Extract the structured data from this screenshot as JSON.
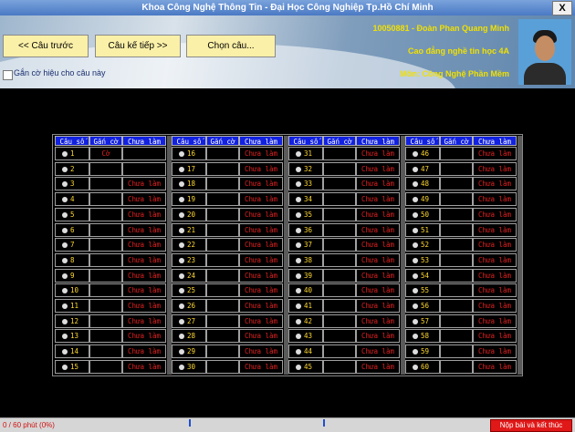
{
  "window": {
    "title": "Khoa Công Nghệ Thông Tin - Đại Học Công Nghiệp Tp.Hồ Chí Minh",
    "close_label": "X"
  },
  "toolbar": {
    "prev_label": "<< Câu trước",
    "next_label": "Câu kế tiếp >>",
    "choose_label": "Chọn câu..."
  },
  "flag_option": {
    "label": "Gắn cờ hiệu cho câu này"
  },
  "student": {
    "id_name": "10050881 - Đoàn Phan Quang Minh",
    "class": "Cao đẳng nghề tin học 4A",
    "subject": "Môn: Công Nghệ Phần Mềm"
  },
  "grid": {
    "headers": {
      "question": "Câu số",
      "flag": "Gắn cờ",
      "status": "Chưa làm"
    },
    "groups": [
      {
        "rows": [
          {
            "num": "1",
            "flag": "Cờ",
            "status": ""
          },
          {
            "num": "2",
            "flag": "",
            "status": ""
          },
          {
            "num": "3",
            "flag": "",
            "status": "Chưa làm"
          },
          {
            "num": "4",
            "flag": "",
            "status": "Chưa làm"
          },
          {
            "num": "5",
            "flag": "",
            "status": "Chưa làm"
          },
          {
            "num": "6",
            "flag": "",
            "status": "Chưa làm"
          },
          {
            "num": "7",
            "flag": "",
            "status": "Chưa làm"
          },
          {
            "num": "8",
            "flag": "",
            "status": "Chưa làm"
          },
          {
            "num": "9",
            "flag": "",
            "status": "Chưa làm"
          },
          {
            "num": "10",
            "flag": "",
            "status": "Chưa làm"
          },
          {
            "num": "11",
            "flag": "",
            "status": "Chưa làm"
          },
          {
            "num": "12",
            "flag": "",
            "status": "Chưa làm"
          },
          {
            "num": "13",
            "flag": "",
            "status": "Chưa làm"
          },
          {
            "num": "14",
            "flag": "",
            "status": "Chưa làm"
          },
          {
            "num": "15",
            "flag": "",
            "status": "Chưa làm"
          }
        ]
      },
      {
        "rows": [
          {
            "num": "16",
            "flag": "",
            "status": "Chưa làm"
          },
          {
            "num": "17",
            "flag": "",
            "status": "Chưa làm"
          },
          {
            "num": "18",
            "flag": "",
            "status": "Chưa làm"
          },
          {
            "num": "19",
            "flag": "",
            "status": "Chưa làm"
          },
          {
            "num": "20",
            "flag": "",
            "status": "Chưa làm"
          },
          {
            "num": "21",
            "flag": "",
            "status": "Chưa làm"
          },
          {
            "num": "22",
            "flag": "",
            "status": "Chưa làm"
          },
          {
            "num": "23",
            "flag": "",
            "status": "Chưa làm"
          },
          {
            "num": "24",
            "flag": "",
            "status": "Chưa làm"
          },
          {
            "num": "25",
            "flag": "",
            "status": "Chưa làm"
          },
          {
            "num": "26",
            "flag": "",
            "status": "Chưa làm"
          },
          {
            "num": "27",
            "flag": "",
            "status": "Chưa làm"
          },
          {
            "num": "28",
            "flag": "",
            "status": "Chưa làm"
          },
          {
            "num": "29",
            "flag": "",
            "status": "Chưa làm"
          },
          {
            "num": "30",
            "flag": "",
            "status": "Chưa làm"
          }
        ]
      },
      {
        "rows": [
          {
            "num": "31",
            "flag": "",
            "status": "Chưa làm"
          },
          {
            "num": "32",
            "flag": "",
            "status": "Chưa làm"
          },
          {
            "num": "33",
            "flag": "",
            "status": "Chưa làm"
          },
          {
            "num": "34",
            "flag": "",
            "status": "Chưa làm"
          },
          {
            "num": "35",
            "flag": "",
            "status": "Chưa làm"
          },
          {
            "num": "36",
            "flag": "",
            "status": "Chưa làm"
          },
          {
            "num": "37",
            "flag": "",
            "status": "Chưa làm"
          },
          {
            "num": "38",
            "flag": "",
            "status": "Chưa làm"
          },
          {
            "num": "39",
            "flag": "",
            "status": "Chưa làm"
          },
          {
            "num": "40",
            "flag": "",
            "status": "Chưa làm"
          },
          {
            "num": "41",
            "flag": "",
            "status": "Chưa làm"
          },
          {
            "num": "42",
            "flag": "",
            "status": "Chưa làm"
          },
          {
            "num": "43",
            "flag": "",
            "status": "Chưa làm"
          },
          {
            "num": "44",
            "flag": "",
            "status": "Chưa làm"
          },
          {
            "num": "45",
            "flag": "",
            "status": "Chưa làm"
          }
        ]
      },
      {
        "rows": [
          {
            "num": "46",
            "flag": "",
            "status": "Chưa làm"
          },
          {
            "num": "47",
            "flag": "",
            "status": "Chưa làm"
          },
          {
            "num": "48",
            "flag": "",
            "status": "Chưa làm"
          },
          {
            "num": "49",
            "flag": "",
            "status": "Chưa làm"
          },
          {
            "num": "50",
            "flag": "",
            "status": "Chưa làm"
          },
          {
            "num": "51",
            "flag": "",
            "status": "Chưa làm"
          },
          {
            "num": "52",
            "flag": "",
            "status": "Chưa làm"
          },
          {
            "num": "53",
            "flag": "",
            "status": "Chưa làm"
          },
          {
            "num": "54",
            "flag": "",
            "status": "Chưa làm"
          },
          {
            "num": "55",
            "flag": "",
            "status": "Chưa làm"
          },
          {
            "num": "56",
            "flag": "",
            "status": "Chưa làm"
          },
          {
            "num": "57",
            "flag": "",
            "status": "Chưa làm"
          },
          {
            "num": "58",
            "flag": "",
            "status": "Chưa làm"
          },
          {
            "num": "59",
            "flag": "",
            "status": "Chưa làm"
          },
          {
            "num": "60",
            "flag": "",
            "status": "Chưa làm"
          }
        ]
      }
    ]
  },
  "status": {
    "progress_text": "0 / 60 phút (0%)",
    "submit_label": "Nộp bài và kết thúc"
  },
  "colors": {
    "header_blue": "#1222e0",
    "number_yellow": "#ffd830",
    "status_red": "#e02020",
    "button_yellow": "#fbf0a8"
  }
}
